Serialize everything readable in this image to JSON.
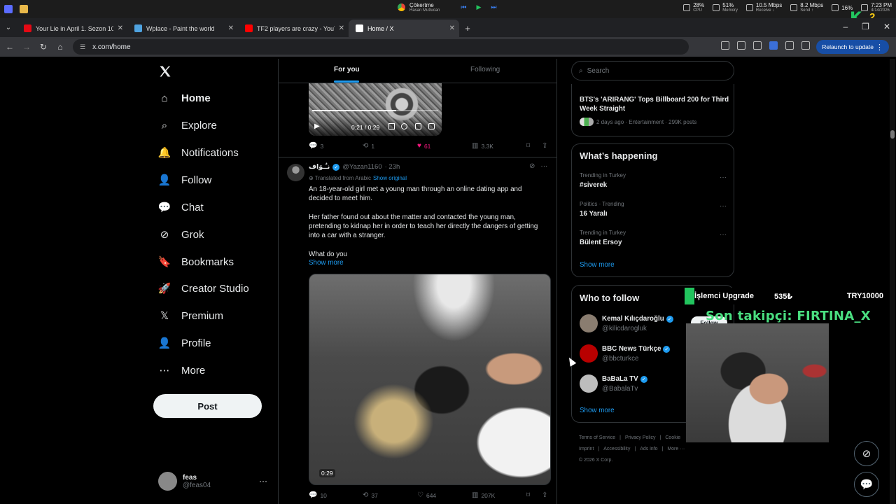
{
  "taskbar": {
    "media": {
      "title": "Çökertme",
      "artist": "Hasan Mutlucan"
    },
    "stats": [
      {
        "value": "28%",
        "label": "CPU"
      },
      {
        "value": "51%",
        "label": "Memory"
      },
      {
        "value": "10.5 Mbps",
        "label": "Receive ↓"
      },
      {
        "value": "8.2 Mbps",
        "label": "Send ↑"
      },
      {
        "value": "16%",
        "label": ""
      },
      {
        "value": "7:23 PM",
        "label": "4/14/2026"
      }
    ]
  },
  "browser": {
    "tabs": [
      {
        "title": "Your Lie in April 1. Sezon 10. Bö",
        "color": "#e50914"
      },
      {
        "title": "Wplace - Paint the world",
        "color": "#4fa3e0"
      },
      {
        "title": "TF2 players are crazy - YouTube",
        "color": "#ff0000"
      },
      {
        "title": "Home / X",
        "color": "#000000",
        "active": true
      }
    ],
    "url": "x.com/home",
    "relaunch_label": "Relaunch to update"
  },
  "nav": {
    "items": [
      {
        "label": "Home",
        "icon": "home-icon",
        "glyph": "⌂"
      },
      {
        "label": "Explore",
        "icon": "search-icon",
        "glyph": "⌕"
      },
      {
        "label": "Notifications",
        "icon": "bell-icon",
        "glyph": "🔔"
      },
      {
        "label": "Follow",
        "icon": "person-add-icon",
        "glyph": "👤"
      },
      {
        "label": "Chat",
        "icon": "chat-icon",
        "glyph": "💬"
      },
      {
        "label": "Grok",
        "icon": "grok-icon",
        "glyph": "⊘"
      },
      {
        "label": "Bookmarks",
        "icon": "bookmark-icon",
        "glyph": "🔖"
      },
      {
        "label": "Creator Studio",
        "icon": "rocket-icon",
        "glyph": "🚀"
      },
      {
        "label": "Premium",
        "icon": "x-logo-icon",
        "glyph": "𝕏"
      },
      {
        "label": "Profile",
        "icon": "profile-icon",
        "glyph": "👤"
      },
      {
        "label": "More",
        "icon": "more-icon",
        "glyph": "⋯"
      }
    ],
    "post_label": "Post",
    "account": {
      "name": "feas",
      "handle": "@feas04"
    }
  },
  "feed": {
    "tabs": {
      "for_you": "For you",
      "following": "Following"
    },
    "prev_post": {
      "video_time": "0:21 / 0:29",
      "replies": "3",
      "reposts": "1",
      "likes": "61",
      "views": "3.3K"
    },
    "post": {
      "name": "نـُـوَاف",
      "handle": "@Yazan1160",
      "time": "· 23h",
      "translated": "Translated from Arabic",
      "show_original": "Show original",
      "p1": "An 18-year-old girl met a young man through an online dating app and decided to meet him.",
      "p2": "Her father found out about the matter and contacted the young man, pretending to kidnap her in order to teach her directly the dangers of getting into a car with a stranger.",
      "p3": "What do you",
      "show_more": "Show more",
      "video_time": "0:29",
      "replies": "10",
      "reposts": "37",
      "likes": "644",
      "views": "207K"
    }
  },
  "sidebar": {
    "search_placeholder": "Search",
    "news": {
      "title": "BTS's 'ARIRANG' Tops Billboard 200 for Third Week Straight",
      "meta": "2 days ago · Entertainment · 299K posts"
    },
    "happening": {
      "title": "What’s happening",
      "trends": [
        {
          "meta": "Trending in Turkey",
          "name": "#siverek"
        },
        {
          "meta": "Politics · Trending",
          "name": "16 Yaralı"
        },
        {
          "meta": "Trending in Turkey",
          "name": "Bülent Ersoy"
        }
      ],
      "show_more": "Show more"
    },
    "who_to_follow": {
      "title": "Who to follow",
      "accounts": [
        {
          "name": "Kemal Kılıçdaroğlu",
          "handle": "@kilicdarogluk",
          "avatar_color": "#8a7d70"
        },
        {
          "name": "BBC News Türkçe",
          "handle": "@bbcturkce",
          "avatar_color": "#b80000"
        },
        {
          "name": "BaBaLa TV",
          "handle": "@BabalaTv",
          "avatar_color": "#bdbdbd"
        }
      ],
      "follow_label": "Follow",
      "show_more": "Show more"
    },
    "footer": {
      "links": [
        "Terms of Service",
        "|",
        "Privacy Policy",
        "|",
        "Cookie"
      ],
      "links2": [
        "Imprint",
        "|",
        "Accessibility",
        "|",
        "Ads info",
        "|",
        "More ···"
      ],
      "copyright": "© 2026 X Corp."
    }
  },
  "overlay": {
    "bar_1": "İşlemci Upgrade",
    "bar_2": "535₺",
    "bar_3": "TRY10000",
    "follower": "Son takipçi: FIRTINA_X",
    "k_num": "2"
  }
}
